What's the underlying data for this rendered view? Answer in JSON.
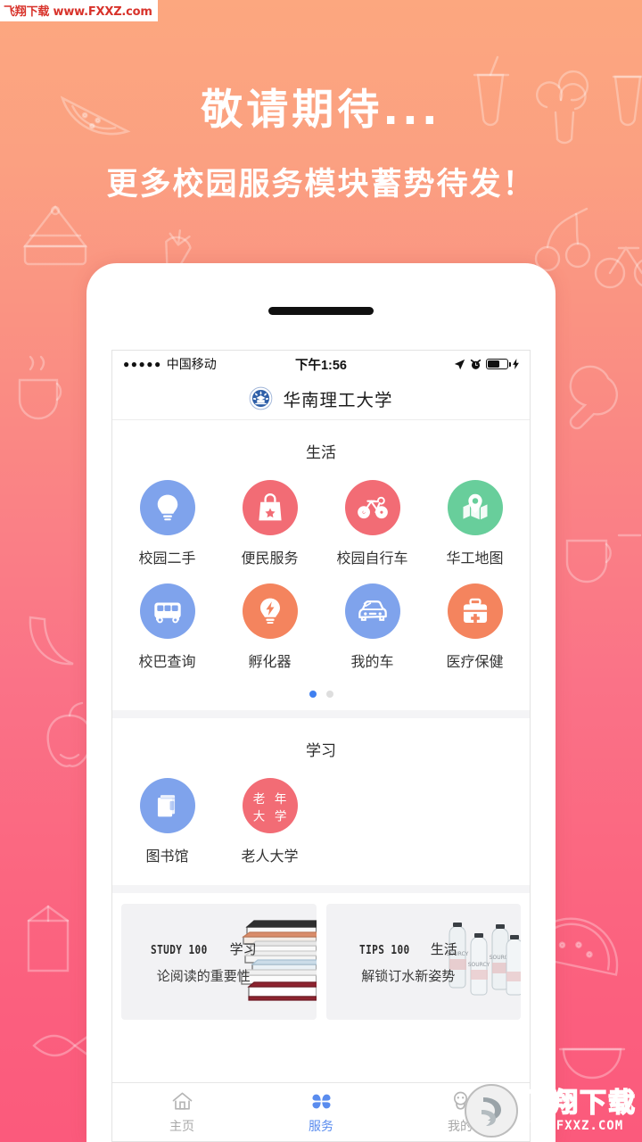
{
  "promo": {
    "title": "敬请期待...",
    "subtitle": "更多校园服务模块蓄势待发！"
  },
  "watermark_top": "飞翔下载 www.FXXZ.com",
  "watermark_bottom": {
    "cn": "飞翔下载",
    "en": "WWW.FXXZ.COM"
  },
  "phone": {
    "status_bar": {
      "signal_dots": "●●●●●",
      "carrier": "中国移动",
      "time": "下午1:56",
      "location_icon": "location-arrow-icon",
      "alarm_icon": "alarm-clock-icon",
      "battery_icon": "battery-charging-icon"
    },
    "app_header": {
      "title": "华南理工大学",
      "logo_icon": "university-crest-icon"
    },
    "sections": [
      {
        "title": "生活",
        "items": [
          {
            "label": "校园二手",
            "icon": "lightbulb-icon",
            "color": "#7FA3EC"
          },
          {
            "label": "便民服务",
            "icon": "shopping-bag-icon",
            "color": "#F26C75"
          },
          {
            "label": "校园自行车",
            "icon": "bicycle-icon",
            "color": "#F26C75"
          },
          {
            "label": "华工地图",
            "icon": "map-pin-icon",
            "color": "#68CE9B"
          },
          {
            "label": "校巴查询",
            "icon": "bus-icon",
            "color": "#7FA3EC"
          },
          {
            "label": "孵化器",
            "icon": "lightning-bulb-icon",
            "color": "#F4845E"
          },
          {
            "label": "我的车",
            "icon": "car-icon",
            "color": "#7FA3EC"
          },
          {
            "label": "医疗保健",
            "icon": "first-aid-kit-icon",
            "color": "#F4845E"
          }
        ],
        "pagination": {
          "pages": 2,
          "active": 1
        }
      },
      {
        "title": "学习",
        "items": [
          {
            "label": "图书馆",
            "icon": "books-icon",
            "color": "#7FA3EC"
          },
          {
            "label": "老人大学",
            "icon": "senior-university-icon",
            "color": "#F26C75",
            "badge_text": "老年\n大学"
          }
        ]
      }
    ],
    "promo_cards": [
      {
        "kicker": "STUDY 100",
        "category": "学习",
        "subtitle": "论阅读的重要性",
        "art": "book-stack-image"
      },
      {
        "kicker": "TIPS 100",
        "category": "生活",
        "subtitle": "解锁订水新姿势",
        "art": "water-bottles-image"
      }
    ],
    "tabs": [
      {
        "label": "主页",
        "icon": "home-icon",
        "active": false
      },
      {
        "label": "服务",
        "icon": "clover-services-icon",
        "active": true
      },
      {
        "label": "我的",
        "icon": "person-icon",
        "active": false
      }
    ]
  },
  "colors": {
    "bg_top": "#FCA77F",
    "bg_bottom": "#FB5A7C",
    "accent_blue": "#4080F0",
    "tab_active": "#5A8CEE"
  }
}
